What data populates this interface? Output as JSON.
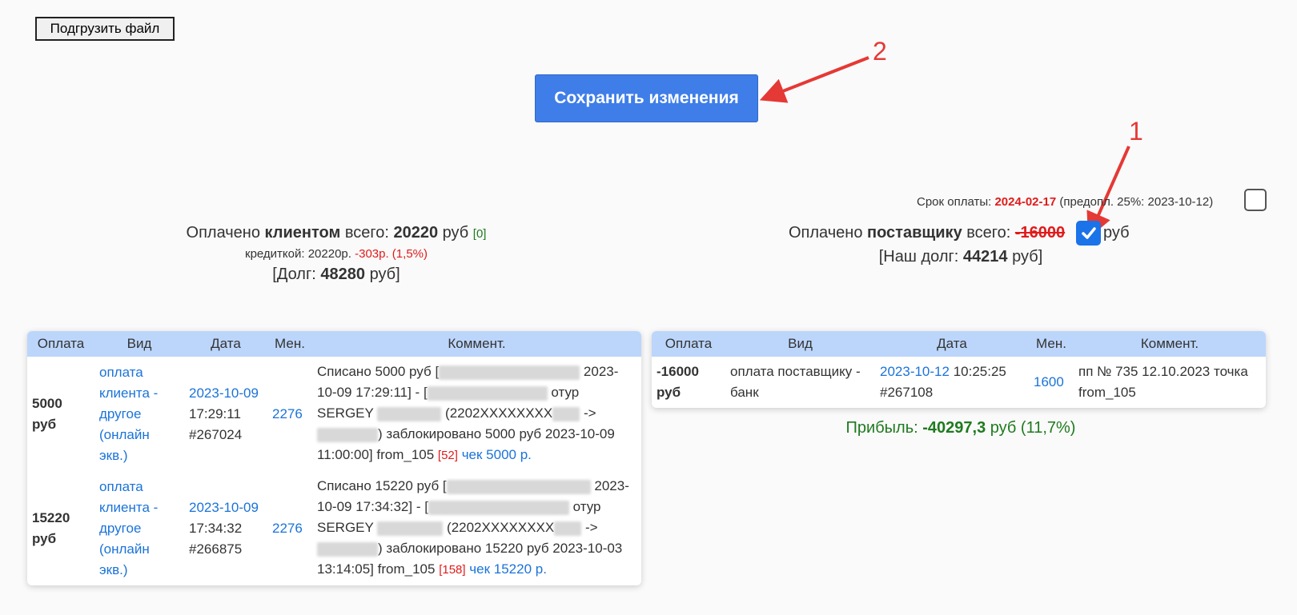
{
  "toolbar": {
    "upload_label": "Подгрузить файл",
    "save_label": "Сохранить изменения"
  },
  "annotations": {
    "one": "1",
    "two": "2"
  },
  "due": {
    "label": "Срок оплаты:",
    "date": "2024-02-17",
    "prepay": "(предопл. 25%: 2023-10-12)"
  },
  "client": {
    "prefix": "Оплачено",
    "who": "клиентом",
    "total_label": "всего:",
    "total": "20220",
    "unit": "руб",
    "bracket": "[0]",
    "card_label": "кредиткой: 20220р.",
    "card_fee": "-303р. (1,5%)",
    "debt_open": "[Долг:",
    "debt": "48280",
    "debt_close": "руб]"
  },
  "supplier": {
    "prefix": "Оплачено",
    "who": "поставщику",
    "total_label": "всего:",
    "total": "-16000",
    "unit": "руб",
    "debt_open": "[Наш долг:",
    "debt": "44214",
    "debt_close": "руб]",
    "checked": true
  },
  "profit": {
    "label": "Прибыль:",
    "value": "-40297,3",
    "unit": "руб (11,7%)"
  },
  "client_table": {
    "headers": [
      "Оплата",
      "Вид",
      "Дата",
      "Мен.",
      "Коммент."
    ],
    "rows": [
      {
        "amount": "5000 руб",
        "type": "оплата клиента - другое (онлайн экв.)",
        "date": "2023-10-09",
        "time": "17:29:11",
        "id": "#267024",
        "manager": "2276",
        "c1": "Списано 5000 руб [",
        "c2": "2023-10-09 17:29:11] - [",
        "c3": "отур SERGEY",
        "c4": "(2202XXXXXXXX",
        "c5": "->",
        "c6": ")",
        "c7": "заблокировано 5000 руб 2023-10-09 11:00:00] from_105",
        "bracket": "[52]",
        "check": "чек 5000 р."
      },
      {
        "amount": "15220 руб",
        "type": "оплата клиента - другое (онлайн экв.)",
        "date": "2023-10-09",
        "time": "17:34:32",
        "id": "#266875",
        "manager": "2276",
        "c1": "Списано 15220 руб [",
        "c2": "2023-10-09 17:34:32] - [",
        "c3": "отур SERGEY",
        "c4": "(2202XXXXXXXX",
        "c5": "->",
        "c6": ")",
        "c7": "заблокировано 15220 руб 2023-10-03 13:14:05] from_105",
        "bracket": "[158]",
        "check": "чек 15220 р."
      }
    ]
  },
  "supplier_table": {
    "headers": [
      "Оплата",
      "Вид",
      "Дата",
      "Мен.",
      "Коммент."
    ],
    "rows": [
      {
        "amount": "-16000 руб",
        "type": "оплата поставщику - банк",
        "date": "2023-10-12",
        "time": "10:25:25",
        "id": "#267108",
        "manager": "1600",
        "comment": "пп № 735 12.10.2023 точка from_105"
      }
    ]
  },
  "colors": {
    "accent": "#3f7ee8",
    "header_bg": "#bcd6fb",
    "red": "#e01b1b",
    "green": "#1f7a1f",
    "link": "#1a73d9"
  }
}
